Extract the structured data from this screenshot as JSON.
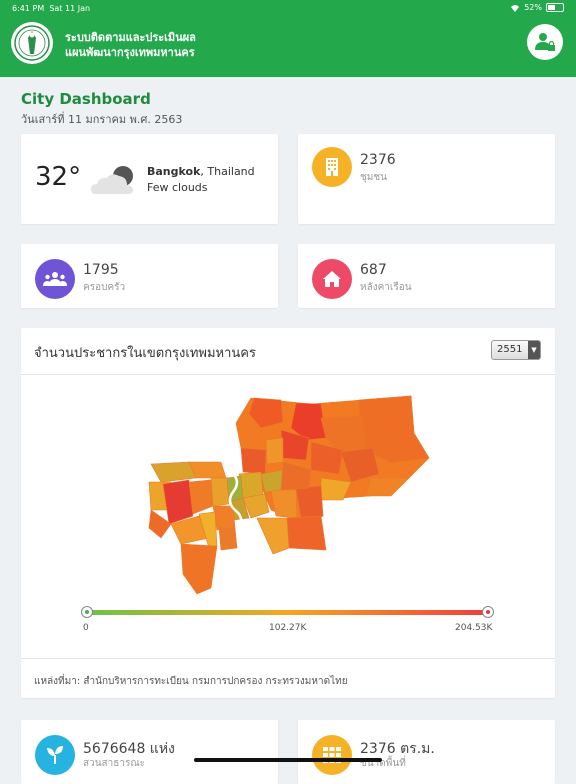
{
  "status_bar": {
    "time": "6:41 PM",
    "date": "Sat 11 Jan",
    "battery": "52%"
  },
  "header": {
    "title_line1": "ระบบติดตามและประเมินผล",
    "title_line2": "แผนพัฒนากรุงเทพมหานคร"
  },
  "page": {
    "title": "City Dashboard",
    "date": "วันเสาร์ที่ 11 มกราคม พ.ศ. 2563"
  },
  "weather": {
    "temperature": "32°",
    "city": "Bangkok",
    "country": ", Thailand",
    "condition": "Few clouds"
  },
  "stats": [
    {
      "value": "2376",
      "label": "ชุมชน",
      "color": "#f5b227",
      "icon": "building-icon"
    },
    {
      "value": "1795",
      "label": "ครอบครัว",
      "color": "#6f55d6",
      "icon": "family-icon"
    },
    {
      "value": "687",
      "label": "หลังคาเรือน",
      "color": "#ee4a67",
      "icon": "house-icon"
    },
    {
      "value": "5676648 แห่ง",
      "label": "สวนสาธารณะ",
      "color": "#27b3e0",
      "icon": "sprout-icon"
    },
    {
      "value": "2376 ตร.ม.",
      "label": "ขนาดพื้นที่",
      "color": "#f5b227",
      "icon": "grid-icon"
    }
  ],
  "map": {
    "title": "จำนวนประชากรในเขตกรุงเทพมหานคร",
    "year": "2551",
    "legend": {
      "min": "0",
      "mid": "102.27K",
      "max": "204.53K"
    },
    "source": "แหล่งที่มา: สำนักบริหารการทะเบียน กรมการปกครอง กระทรวงมหาดไทย"
  },
  "colors": {
    "brand_green": "#23a94c",
    "title_green": "#1d8c3f"
  }
}
